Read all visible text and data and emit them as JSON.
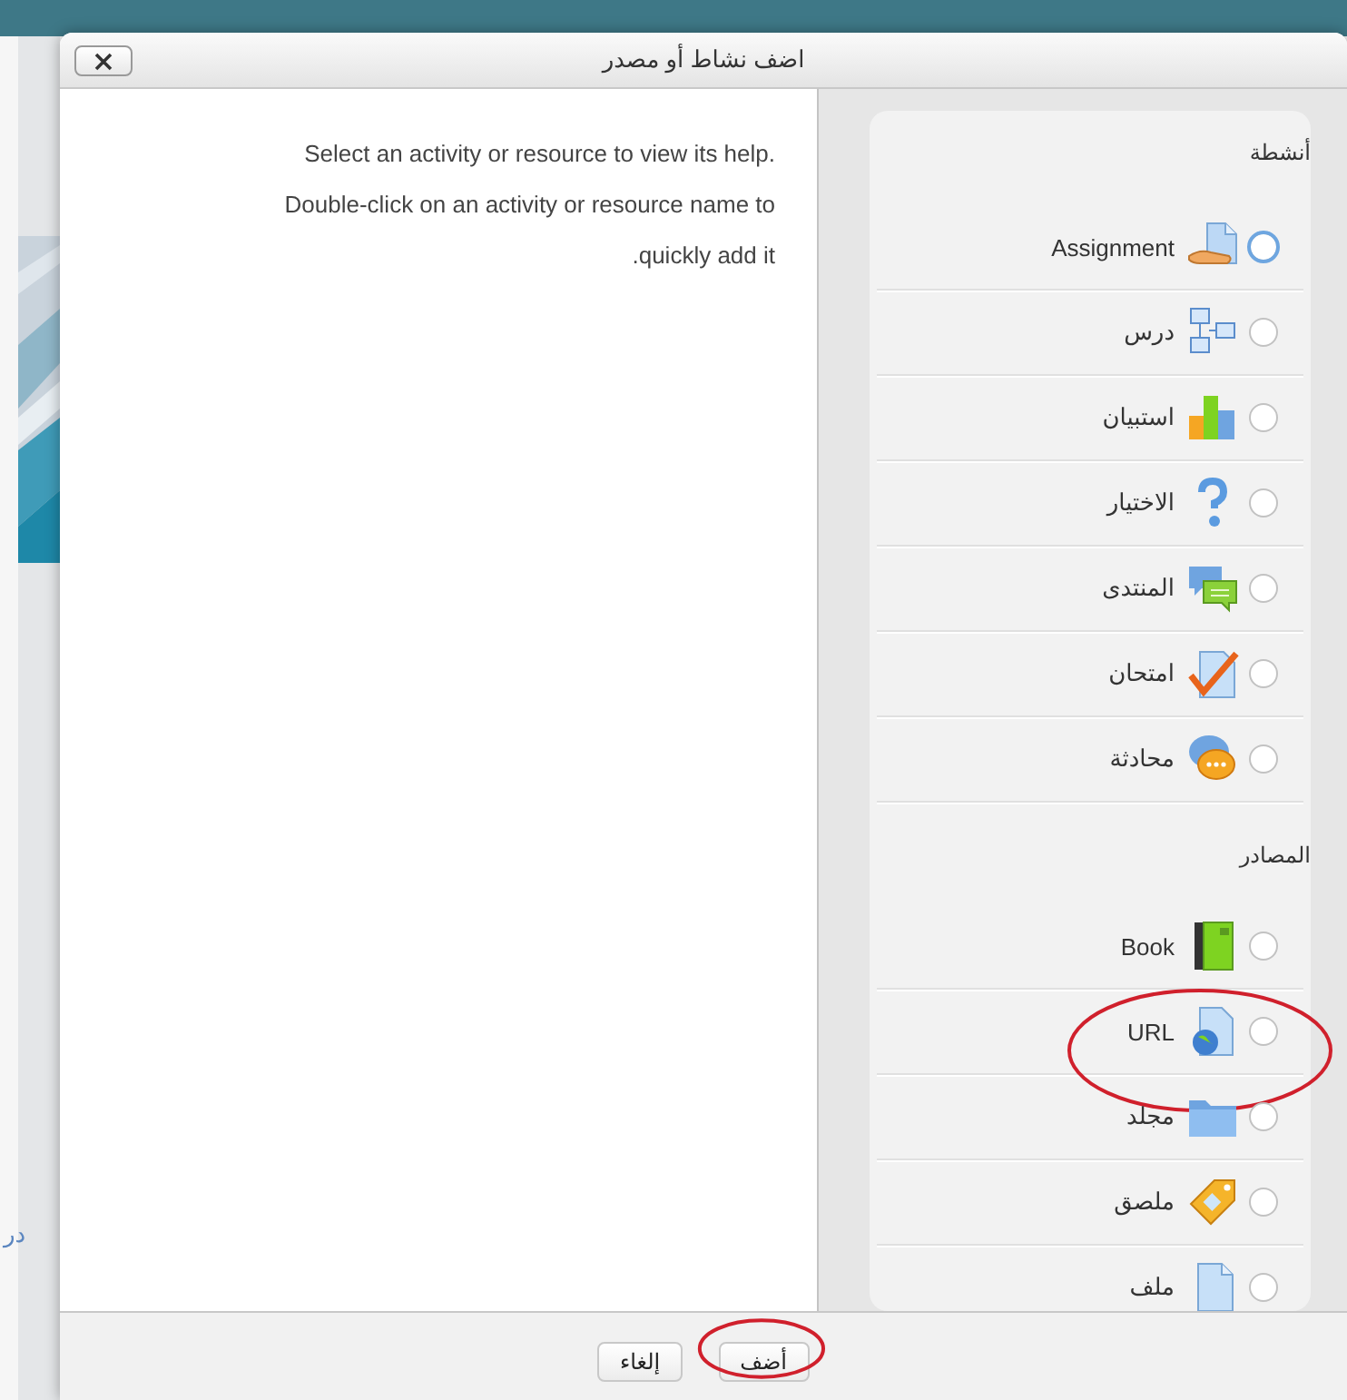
{
  "background": {
    "fragment": "در"
  },
  "dialog": {
    "title": "اضف نشاط أو مصدر"
  },
  "help": "Select an activity or resource to view its help. Double-click on an activity or resource name to quickly add it.",
  "sections": [
    {
      "heading": "أنشطة",
      "items": [
        {
          "label": "Assignment",
          "kind": "assignment",
          "focused": true,
          "circled": false
        },
        {
          "label": "درس",
          "kind": "lesson",
          "focused": false,
          "circled": false
        },
        {
          "label": "استبيان",
          "kind": "survey",
          "focused": false,
          "circled": false
        },
        {
          "label": "الاختيار",
          "kind": "choice",
          "focused": false,
          "circled": false
        },
        {
          "label": "المنتدى",
          "kind": "forum",
          "focused": false,
          "circled": false
        },
        {
          "label": "امتحان",
          "kind": "quiz",
          "focused": false,
          "circled": false
        },
        {
          "label": "محادثة",
          "kind": "chat",
          "focused": false,
          "circled": false
        }
      ]
    },
    {
      "heading": "المصادر",
      "items": [
        {
          "label": "Book",
          "kind": "book",
          "focused": false,
          "circled": false
        },
        {
          "label": "URL",
          "kind": "url",
          "focused": false,
          "circled": true
        },
        {
          "label": "مجلد",
          "kind": "folder",
          "focused": false,
          "circled": false
        },
        {
          "label": "ملصق",
          "kind": "label",
          "focused": false,
          "circled": false
        },
        {
          "label": "ملف",
          "kind": "file",
          "focused": false,
          "circled": false
        }
      ]
    }
  ],
  "buttons": [
    {
      "label": "أضف",
      "circled": true
    },
    {
      "label": "إلغاء",
      "circled": false
    }
  ]
}
